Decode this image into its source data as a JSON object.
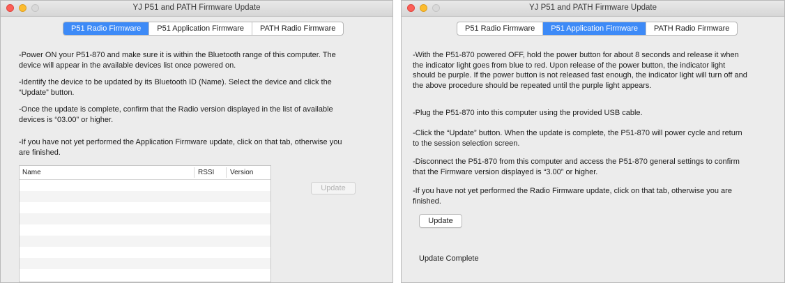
{
  "left_window": {
    "title": "YJ P51 and PATH Firmware Update",
    "tabs": [
      {
        "label": "P51 Radio Firmware",
        "active": true
      },
      {
        "label": "P51 Application Firmware",
        "active": false
      },
      {
        "label": "PATH Radio Firmware",
        "active": false
      }
    ],
    "instructions": [
      "-Power ON your P51-870 and make sure it is within the Bluetooth range of this computer. The device will appear in the available devices list once powered on.",
      "-Identify the device to be updated by its Bluetooth ID (Name). Select the device and click the “Update” button.",
      "-Once the update is complete, confirm that the Radio version displayed in the list of available devices is “03.00” or higher.",
      "-If you have not yet performed the Application Firmware update, click on that tab, otherwise you are finished."
    ],
    "table": {
      "columns": [
        "Name",
        "RSSI",
        "Version"
      ],
      "rows": []
    },
    "update_button": {
      "label": "Update",
      "enabled": false
    }
  },
  "right_window": {
    "title": "YJ P51 and PATH Firmware Update",
    "tabs": [
      {
        "label": "P51 Radio Firmware",
        "active": false
      },
      {
        "label": "P51 Application Firmware",
        "active": true
      },
      {
        "label": "PATH Radio Firmware",
        "active": false
      }
    ],
    "instructions": [
      "-With the P51-870 powered OFF, hold the power button for about 8 seconds and release it when the indicator light goes from blue to red. Upon release of the power button, the indicator light should be purple. If the power button is not released fast enough, the indicator light will turn off and the above procedure should be repeated until the purple light appears.",
      "-Plug the P51-870 into this computer using the provided USB cable.",
      "-Click the “Update” button. When the update is complete, the P51-870 will power cycle and return to the session selection screen.",
      "-Disconnect the P51-870 from this computer and access the P51-870 general settings to confirm that the Firmware version displayed is “3.00” or higher.",
      "-If you have not yet performed the Radio Firmware update, click on that tab, otherwise you are finished."
    ],
    "update_button": {
      "label": "Update",
      "enabled": true
    },
    "status": "Update Complete"
  },
  "colors": {
    "accent": "#3d8af7",
    "window_bg": "#ececec",
    "close": "#fc5f57",
    "minimize": "#fdbc2e"
  }
}
